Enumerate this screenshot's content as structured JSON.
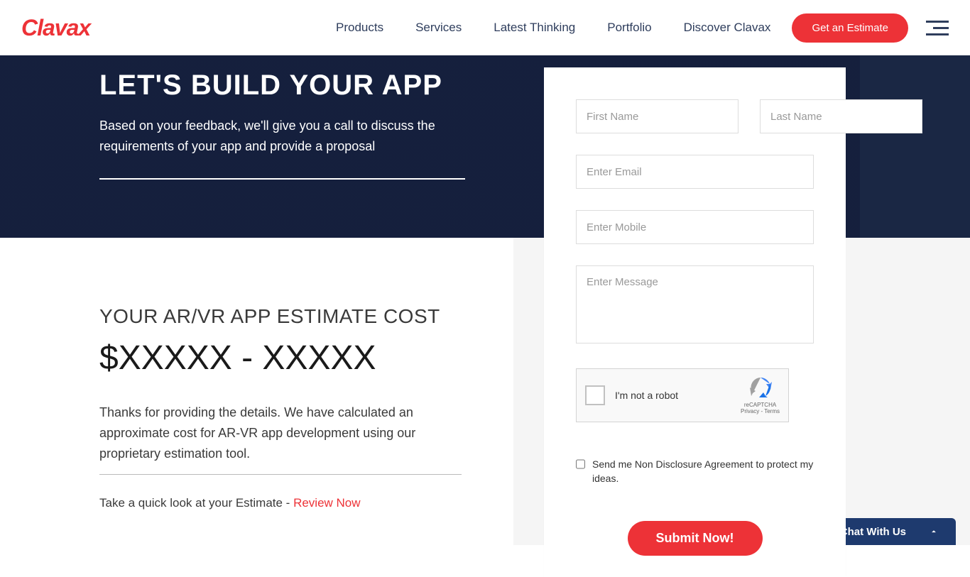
{
  "header": {
    "logo": "Clavax",
    "nav": [
      "Products",
      "Services",
      "Latest Thinking",
      "Portfolio",
      "Discover Clavax"
    ],
    "cta": "Get an Estimate"
  },
  "hero": {
    "title": "LET'S BUILD YOUR APP",
    "subtitle": "Based on your feedback, we'll give you a call to discuss the requirements of your app and provide a proposal"
  },
  "estimate": {
    "title": "YOUR AR/VR APP ESTIMATE COST",
    "price": "$XXXXX - XXXXX",
    "thanks": "Thanks for providing the details. We have calculated an approximate cost for AR-VR app development using our proprietary estimation tool.",
    "review_prefix": "Take a quick look at your Estimate - ",
    "review_link": "Review Now"
  },
  "form": {
    "first_name_ph": "First Name",
    "last_name_ph": "Last Name",
    "email_ph": "Enter Email",
    "mobile_ph": "Enter Mobile",
    "message_ph": "Enter Message",
    "recaptcha_text": "I'm not a robot",
    "recaptcha_badge": "reCAPTCHA",
    "recaptcha_terms": "Privacy - Terms",
    "nda_label": "Send me Non Disclosure Agreement to protect my ideas.",
    "submit": "Submit Now!"
  },
  "chat": {
    "label": "Chat With Us"
  }
}
